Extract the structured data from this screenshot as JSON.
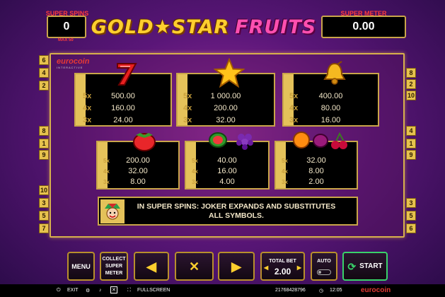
{
  "header": {
    "super_spins_label": "SUPER SPINS",
    "super_spins_value": "0",
    "max_label": "MAX 50",
    "super_meter_label": "SUPER METER",
    "super_meter_value": "0.00",
    "logo_gold": "GOLD★STAR",
    "logo_fruits": "FRUITS"
  },
  "brand": {
    "name": "eurocoin",
    "sub": "INTERACTIVE"
  },
  "left_numbers": [
    "6",
    "4",
    "2",
    "8",
    "1",
    "9",
    "10",
    "3",
    "5",
    "7"
  ],
  "right_numbers": [
    "8",
    "2",
    "10",
    "4",
    "1",
    "9",
    "3",
    "5",
    "6"
  ],
  "paytable": {
    "multipliers": [
      "5x",
      "4x",
      "3x"
    ],
    "seven": [
      "500.00",
      "160.00",
      "24.00"
    ],
    "star": [
      "1 000.00",
      "200.00",
      "32.00"
    ],
    "bell": [
      "400.00",
      "80.00",
      "16.00"
    ],
    "strawberry": [
      "200.00",
      "32.00",
      "8.00"
    ],
    "melon_grapes": [
      "40.00",
      "16.00",
      "4.00"
    ],
    "orange_plum_cherry": [
      "32.00",
      "8.00",
      "2.00"
    ]
  },
  "info_text": "IN SUPER SPINS: JOKER EXPANDS AND SUBSTITUTES ALL SYMBOLS.",
  "controls": {
    "menu": "MENU",
    "collect": "COLLECT SUPER METER",
    "prev": "◀",
    "close": "✕",
    "next": "▶",
    "total_bet_label": "TOTAL BET",
    "total_bet_value": "2.00",
    "auto": "AUTO",
    "start": "START"
  },
  "footer": {
    "exit": "EXIT",
    "fullscreen": "FULLSCREEN",
    "session_id": "21768428796",
    "time": "12:05",
    "brand": "eurocoin"
  },
  "colors": {
    "gold": "#c9a54a",
    "accent_green": "#39d26a"
  }
}
